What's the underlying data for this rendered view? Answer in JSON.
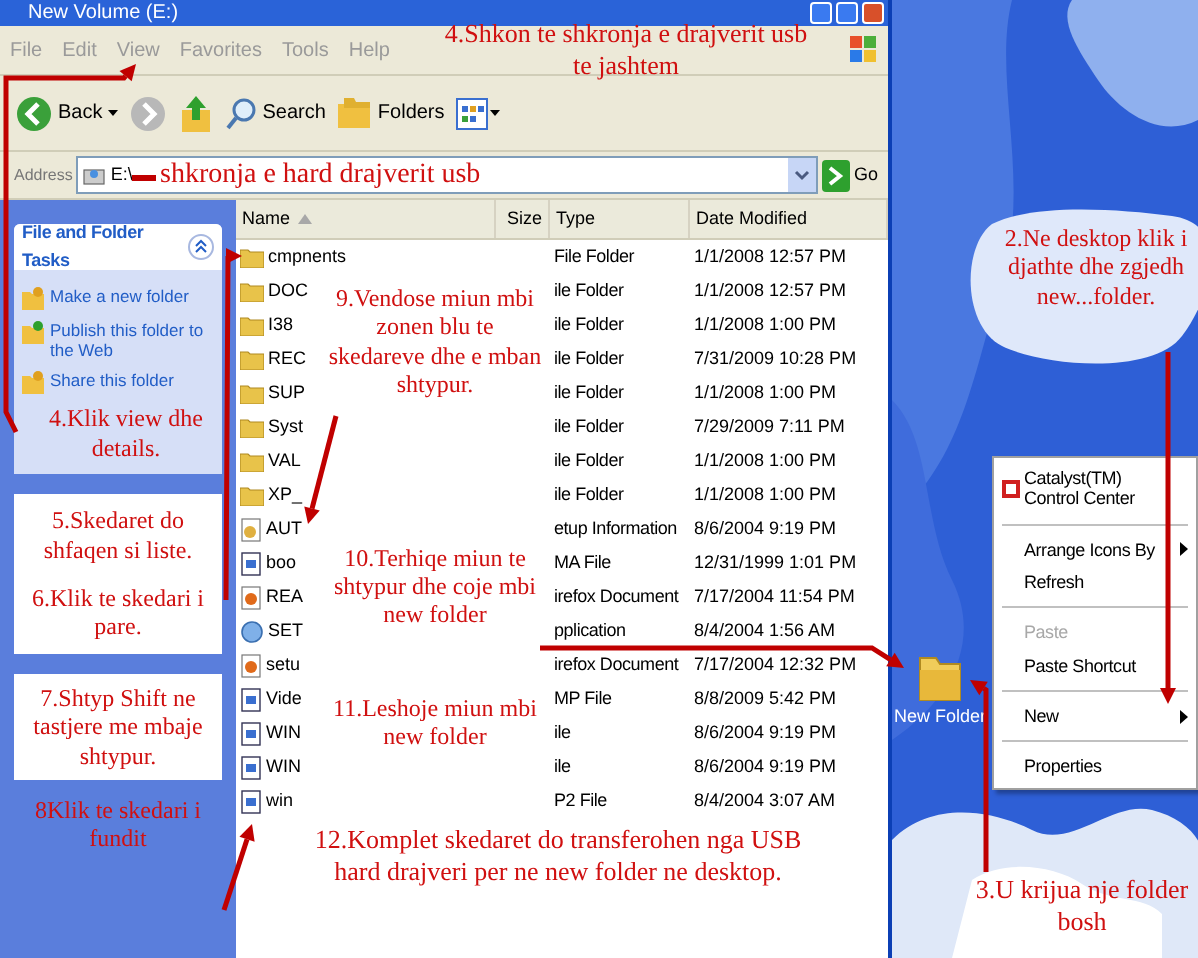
{
  "window": {
    "title": "New Volume (E:)"
  },
  "menu": [
    "File",
    "Edit",
    "View",
    "Favorites",
    "Tools",
    "Help"
  ],
  "toolbar": {
    "back": "Back",
    "search": "Search",
    "folders": "Folders"
  },
  "address": {
    "label": "Address",
    "value": "E:\\",
    "go": "Go"
  },
  "task_pane": {
    "title": "File and Folder Tasks",
    "items": [
      "Make a new folder",
      "Publish this folder to the Web",
      "Share this folder"
    ]
  },
  "file_list": {
    "columns": [
      "Name",
      "Size",
      "Type",
      "Date Modified"
    ],
    "rows": [
      {
        "kind": "folder",
        "name": "cmpnents",
        "type": "File Folder",
        "date": "1/1/2008 12:57 PM"
      },
      {
        "kind": "folder",
        "name": "DOC",
        "type": "ile Folder",
        "date": "1/1/2008 12:57 PM"
      },
      {
        "kind": "folder",
        "name": "I38",
        "type": "ile Folder",
        "date": "1/1/2008 1:00 PM"
      },
      {
        "kind": "folder",
        "name": "REC",
        "type": "ile Folder",
        "date": "7/31/2009 10:28 PM"
      },
      {
        "kind": "folder",
        "name": "SUP",
        "type": "ile Folder",
        "date": "1/1/2008 1:00 PM"
      },
      {
        "kind": "folder",
        "name": "Syst",
        "type": "ile Folder",
        "date": "7/29/2009 7:11 PM"
      },
      {
        "kind": "folder",
        "name": "VAL",
        "type": "ile Folder",
        "date": "1/1/2008 1:00 PM"
      },
      {
        "kind": "folder",
        "name": "XP_",
        "type": "ile Folder",
        "date": "1/1/2008 1:00 PM"
      },
      {
        "kind": "setup",
        "name": "AUT",
        "type": "etup Information",
        "date": "8/6/2004 9:19 PM"
      },
      {
        "kind": "file",
        "name": "boo",
        "type": "MA File",
        "date": "12/31/1999 1:01 PM"
      },
      {
        "kind": "firefox",
        "name": "REA",
        "type": "irefox Document",
        "date": "7/17/2004 11:54 PM"
      },
      {
        "kind": "app",
        "name": "SET",
        "type": "pplication",
        "date": "8/4/2004 1:56 AM"
      },
      {
        "kind": "firefox",
        "name": "setu",
        "type": "irefox Document",
        "date": "7/17/2004 12:32 PM"
      },
      {
        "kind": "file",
        "name": "Vide",
        "type": "MP File",
        "date": "8/8/2009 5:42 PM"
      },
      {
        "kind": "file",
        "name": "WIN",
        "type": "ile",
        "date": "8/6/2004 9:19 PM"
      },
      {
        "kind": "file",
        "name": "WIN",
        "type": "ile",
        "date": "8/6/2004 9:19 PM"
      },
      {
        "kind": "file",
        "name": "win",
        "type": "P2 File",
        "date": "8/4/2004 3:07 AM"
      }
    ]
  },
  "desktop": {
    "icon_label": "New Folder",
    "context_menu": [
      {
        "kind": "app",
        "label": "Catalyst(TM) Control Center",
        "disabled": false,
        "submenu": false
      },
      {
        "kind": "separator"
      },
      {
        "kind": "item",
        "label": "Arrange Icons By",
        "disabled": false,
        "submenu": true
      },
      {
        "kind": "item",
        "label": "Refresh",
        "disabled": false,
        "submenu": false
      },
      {
        "kind": "separator"
      },
      {
        "kind": "item",
        "label": "Paste",
        "disabled": true,
        "submenu": false
      },
      {
        "kind": "item",
        "label": "Paste Shortcut",
        "disabled": false,
        "submenu": false
      },
      {
        "kind": "separator"
      },
      {
        "kind": "item",
        "label": "New",
        "disabled": false,
        "submenu": true
      },
      {
        "kind": "separator"
      },
      {
        "kind": "item",
        "label": "Properties",
        "disabled": false,
        "submenu": false
      }
    ]
  },
  "annotations": [
    "4.Shkon te shkronja e drajverit usb te jashtem",
    "shkronja e hard drajverit usb",
    "4.Klik view dhe details.",
    "5.Skedaret do shfaqen si liste.",
    "6.Klik te skedari i pare.",
    "7.Shtyp Shift ne tastjere me mbaje shtypur.",
    "8Klik te skedari i fundit",
    "9.Vendose miun mbi zonen blu te skedareve dhe e mban shtypur.",
    "10.Terhiqe miun te shtypur dhe coje mbi new folder",
    "11.Leshoje miun mbi new folder",
    "12.Komplet skedaret do transferohen nga USB hard drajveri per ne new folder ne desktop.",
    "2.Ne desktop klik i djathte dhe zgjedh new...folder.",
    "3.U krijua nje folder bosh"
  ]
}
